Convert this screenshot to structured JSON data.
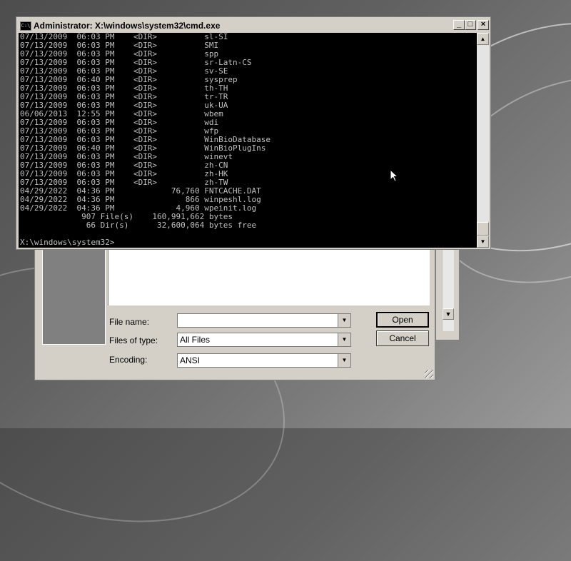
{
  "cmd_window": {
    "title": "Administrator: X:\\windows\\system32\\cmd.exe",
    "icon_text": "C:\\",
    "min_label": "_",
    "max_label": "□",
    "close_label": "×",
    "lines": [
      "07/13/2009  06:03 PM    <DIR>          sl-SI",
      "07/13/2009  06:03 PM    <DIR>          SMI",
      "07/13/2009  06:03 PM    <DIR>          spp",
      "07/13/2009  06:03 PM    <DIR>          sr-Latn-CS",
      "07/13/2009  06:03 PM    <DIR>          sv-SE",
      "07/13/2009  06:40 PM    <DIR>          sysprep",
      "07/13/2009  06:03 PM    <DIR>          th-TH",
      "07/13/2009  06:03 PM    <DIR>          tr-TR",
      "07/13/2009  06:03 PM    <DIR>          uk-UA",
      "06/06/2013  12:55 PM    <DIR>          wbem",
      "07/13/2009  06:03 PM    <DIR>          wdi",
      "07/13/2009  06:03 PM    <DIR>          wfp",
      "07/13/2009  06:03 PM    <DIR>          WinBioDatabase",
      "07/13/2009  06:40 PM    <DIR>          WinBioPlugIns",
      "07/13/2009  06:03 PM    <DIR>          winevt",
      "07/13/2009  06:03 PM    <DIR>          zh-CN",
      "07/13/2009  06:03 PM    <DIR>          zh-HK",
      "07/13/2009  06:03 PM    <DIR>          zh-TW",
      "04/29/2022  04:36 PM            76,760 FNTCACHE.DAT",
      "04/29/2022  04:36 PM               866 winpeshl.log",
      "04/29/2022  04:36 PM             4,960 wpeinit.log",
      "             907 File(s)    160,991,662 bytes",
      "              66 Dir(s)      32,600,064 bytes free",
      "",
      "X:\\windows\\system32>"
    ]
  },
  "file_dialog": {
    "file_name_label": "File name:",
    "file_name_value": "",
    "file_type_label": "Files of type:",
    "file_type_value": "All Files",
    "encoding_label": "Encoding:",
    "encoding_value": "ANSI",
    "open_label": "Open",
    "cancel_label": "Cancel"
  }
}
